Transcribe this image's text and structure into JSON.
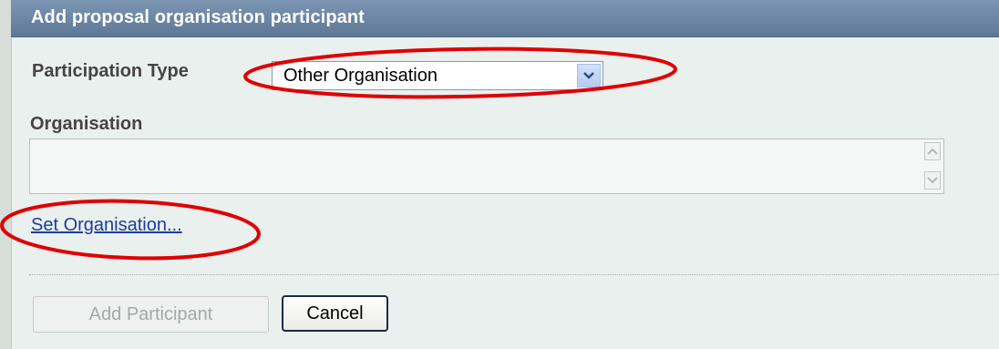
{
  "dialog": {
    "title": "Add proposal organisation participant"
  },
  "form": {
    "participation_type_label": "Participation Type",
    "participation_type_value": "Other Organisation",
    "organisation_label": "Organisation",
    "organisation_value": "",
    "set_organisation_link": "Set Organisation..."
  },
  "buttons": {
    "add_participant": "Add Participant",
    "cancel": "Cancel"
  },
  "annotations": {
    "highlight_color": "#e00000"
  },
  "icons": {
    "select_arrow": "chevron-down-icon",
    "scroll_up": "scroll-up-arrow-icon",
    "scroll_down": "scroll-down-arrow-icon"
  }
}
